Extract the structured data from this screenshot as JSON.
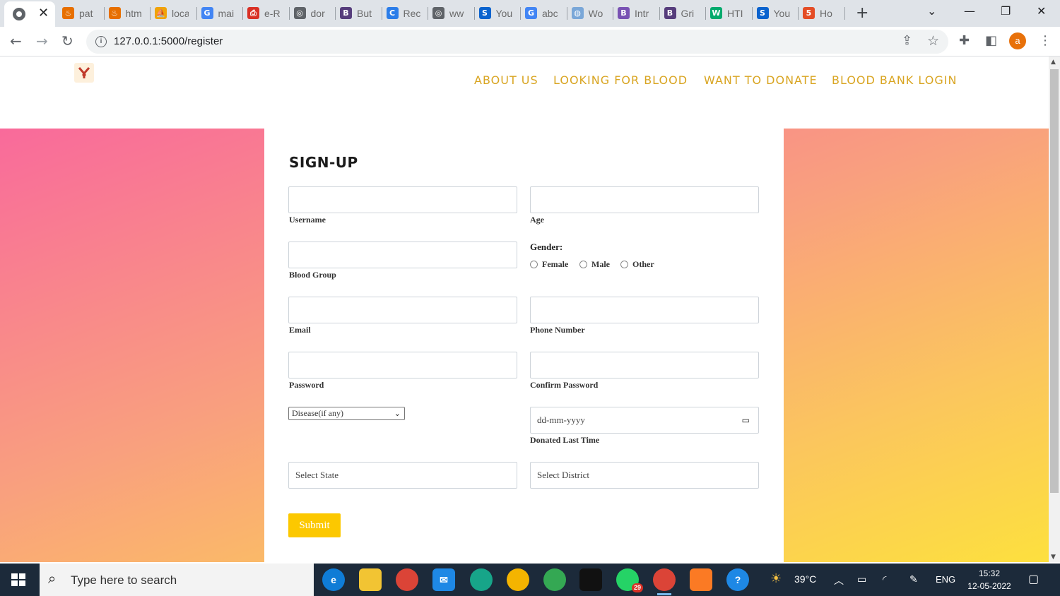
{
  "browser": {
    "tabs": [
      {
        "label": "pat",
        "icon": "java-icon",
        "color": "#e76f00"
      },
      {
        "label": "htm",
        "icon": "java-icon",
        "color": "#e76f00"
      },
      {
        "label": "loca",
        "icon": "pma-icon",
        "color": "#f0a30a"
      },
      {
        "label": "mai",
        "icon": "google-icon",
        "color": "#4285f4"
      },
      {
        "label": "e-R",
        "icon": "printer-icon",
        "color": "#d93025"
      },
      {
        "label": "dor",
        "icon": "globe-icon",
        "color": "#5f6368"
      },
      {
        "label": "But",
        "icon": "bootstrap-icon",
        "color": "#563d7c"
      },
      {
        "label": "Rec",
        "icon": "c-icon",
        "color": "#2b7de9"
      },
      {
        "label": "ww",
        "icon": "globe-icon",
        "color": "#5f6368"
      },
      {
        "label": "You",
        "icon": "s-icon",
        "color": "#0b63ce"
      },
      {
        "label": "abc",
        "icon": "google-icon",
        "color": "#4285f4"
      },
      {
        "label": "Wo",
        "icon": "world-icon",
        "color": "#7aa7d8"
      },
      {
        "label": "Intr",
        "icon": "bootstrap-icon",
        "color": "#7952b3"
      },
      {
        "label": "Gri",
        "icon": "bootstrap-icon",
        "color": "#563d7c"
      },
      {
        "label": "HTI",
        "icon": "w3-icon",
        "color": "#04aa6d"
      },
      {
        "label": "You",
        "icon": "s-icon",
        "color": "#0b63ce"
      },
      {
        "label": "Ho",
        "icon": "html5-icon",
        "color": "#e44d26"
      }
    ],
    "url": "127.0.0.1:5000/register",
    "profile_initial": "a"
  },
  "site": {
    "nav": [
      "ABOUT US",
      "LOOKING FOR BLOOD",
      "WANT TO DONATE",
      "BLOOD BANK LOGIN"
    ],
    "accent": "#d9a522"
  },
  "form": {
    "title": "SIGN-UP",
    "labels": {
      "username": "Username",
      "age": "Age",
      "blood_group": "Blood Group",
      "email": "Email",
      "phone": "Phone Number",
      "password": "Password",
      "confirm_password": "Confirm Password",
      "donated_last_time": "Donated Last Time"
    },
    "gender": {
      "title": "Gender:",
      "options": [
        "Female",
        "Male",
        "Other"
      ]
    },
    "disease_select": "Disease(if any)",
    "date_placeholder": "dd-mm-yyyy",
    "state_placeholder": "Select State",
    "district_placeholder": "Select District",
    "submit_label": "Submit",
    "submit_color": "#fcc800"
  },
  "taskbar": {
    "search_placeholder": "Type here to search",
    "weather": "39°C",
    "language": "ENG",
    "time": "15:32",
    "date": "12-05-2022",
    "whatsapp_badge": "29"
  }
}
